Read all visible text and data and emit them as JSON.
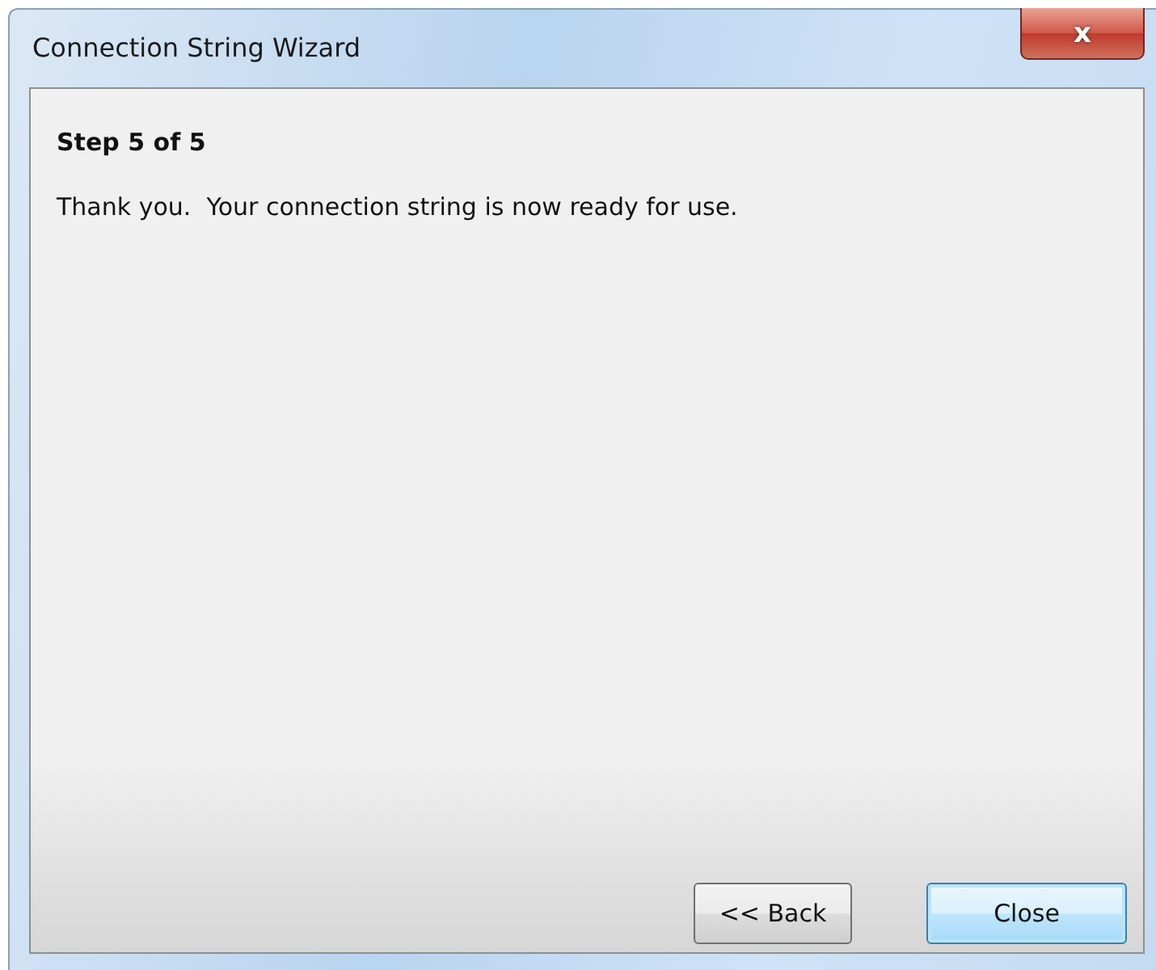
{
  "window": {
    "title": "Connection String Wizard",
    "close_glyph": "x"
  },
  "step": "Step 5 of 5",
  "message": "Thank you.  Your connection string is now ready for use.",
  "buttons": [
    {
      "label": "<< Back",
      "focused": false
    },
    {
      "label": "Close",
      "focused": true
    }
  ]
}
